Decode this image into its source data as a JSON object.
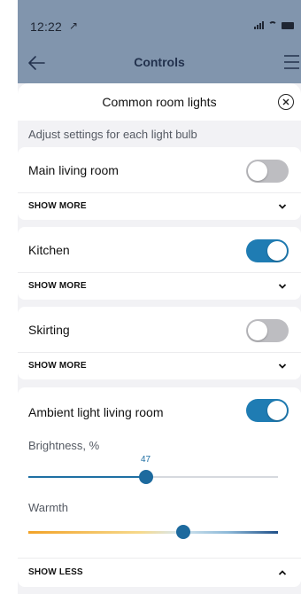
{
  "status": {
    "time": "12:22"
  },
  "nav": {
    "title": "Controls"
  },
  "sheet": {
    "title": "Common room lights",
    "subtitle": "Adjust settings for each light bulb"
  },
  "lights": [
    {
      "name": "Main living room",
      "on": false,
      "more_label": "SHOW MORE"
    },
    {
      "name": "Kitchen",
      "on": true,
      "more_label": "SHOW MORE"
    },
    {
      "name": "Skirting",
      "on": false,
      "more_label": "SHOW MORE"
    },
    {
      "name": "Ambient light living room",
      "on": true,
      "more_label": "SHOW LESS"
    }
  ],
  "ambient": {
    "brightness_label": "Brightness, %",
    "brightness_value": "47",
    "warmth_label": "Warmth",
    "warmth_fraction": 0.62
  },
  "colors": {
    "nav": "#8195ad",
    "toggle_on": "#1f7cb3",
    "toggle_off": "#bdbdc1"
  }
}
